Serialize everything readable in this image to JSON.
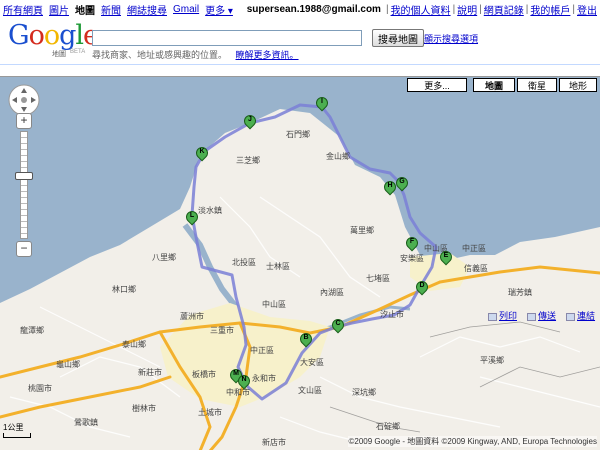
{
  "nav": {
    "items": [
      "所有網頁",
      "圖片",
      "地圖",
      "新聞",
      "網誌搜尋",
      "Gmail",
      "更多 ▾"
    ],
    "active": "地圖"
  },
  "account": {
    "email": "supersean.1988@gmail.com",
    "links": [
      "我的個人資料",
      "說明",
      "網頁記錄",
      "我的帳戶",
      "登出"
    ]
  },
  "logo": {
    "text": "Google",
    "subtitle": "地圖",
    "beta": "BETA"
  },
  "search": {
    "value": "",
    "button": "搜尋地圖",
    "options_link": "顯示搜尋選項",
    "hint": "尋找商家、地址或感興趣的位置。",
    "hint_link": "瞭解更多資訊。"
  },
  "map_types": [
    "更多...",
    "地圖",
    "衛星",
    "地形"
  ],
  "tools": [
    "列印",
    "傳送",
    "連結"
  ],
  "scale": "1公里",
  "copyright": "©2009 Google - 地圖資料 ©2009 Kingway, AND, Europa Technologies",
  "colors": {
    "water": "#99b3cc",
    "land": "#f2efe9",
    "urban": "#f7f1cb",
    "route": "#7a7fd6",
    "highway": "#f3b12c",
    "marker": "#4caf50"
  },
  "markers": [
    "A",
    "B",
    "C",
    "D",
    "E",
    "F",
    "G",
    "H",
    "I",
    "J",
    "K",
    "L",
    "M",
    "N"
  ],
  "places": [
    "石門鄉",
    "三芝鄉",
    "金山鄉",
    "萬里鄉",
    "淡水鎮",
    "八里鄉",
    "林口鄉",
    "北投區",
    "士林區",
    "中山區",
    "內湖區",
    "汐止市",
    "中正區",
    "大安區",
    "三重市",
    "蘆洲市",
    "泰山鄉",
    "新莊市",
    "板橋市",
    "中和市",
    "永和市",
    "文山區",
    "深坑鄉",
    "石碇鄉",
    "新店市",
    "土城市",
    "樹林市",
    "鶯歌鎮",
    "瑞芳鎮",
    "平溪鄉",
    "七堵區",
    "安樂區",
    "中山區",
    "信義區",
    "中正區",
    "桃園市",
    "龜山鄉",
    "龍潭鄉"
  ]
}
